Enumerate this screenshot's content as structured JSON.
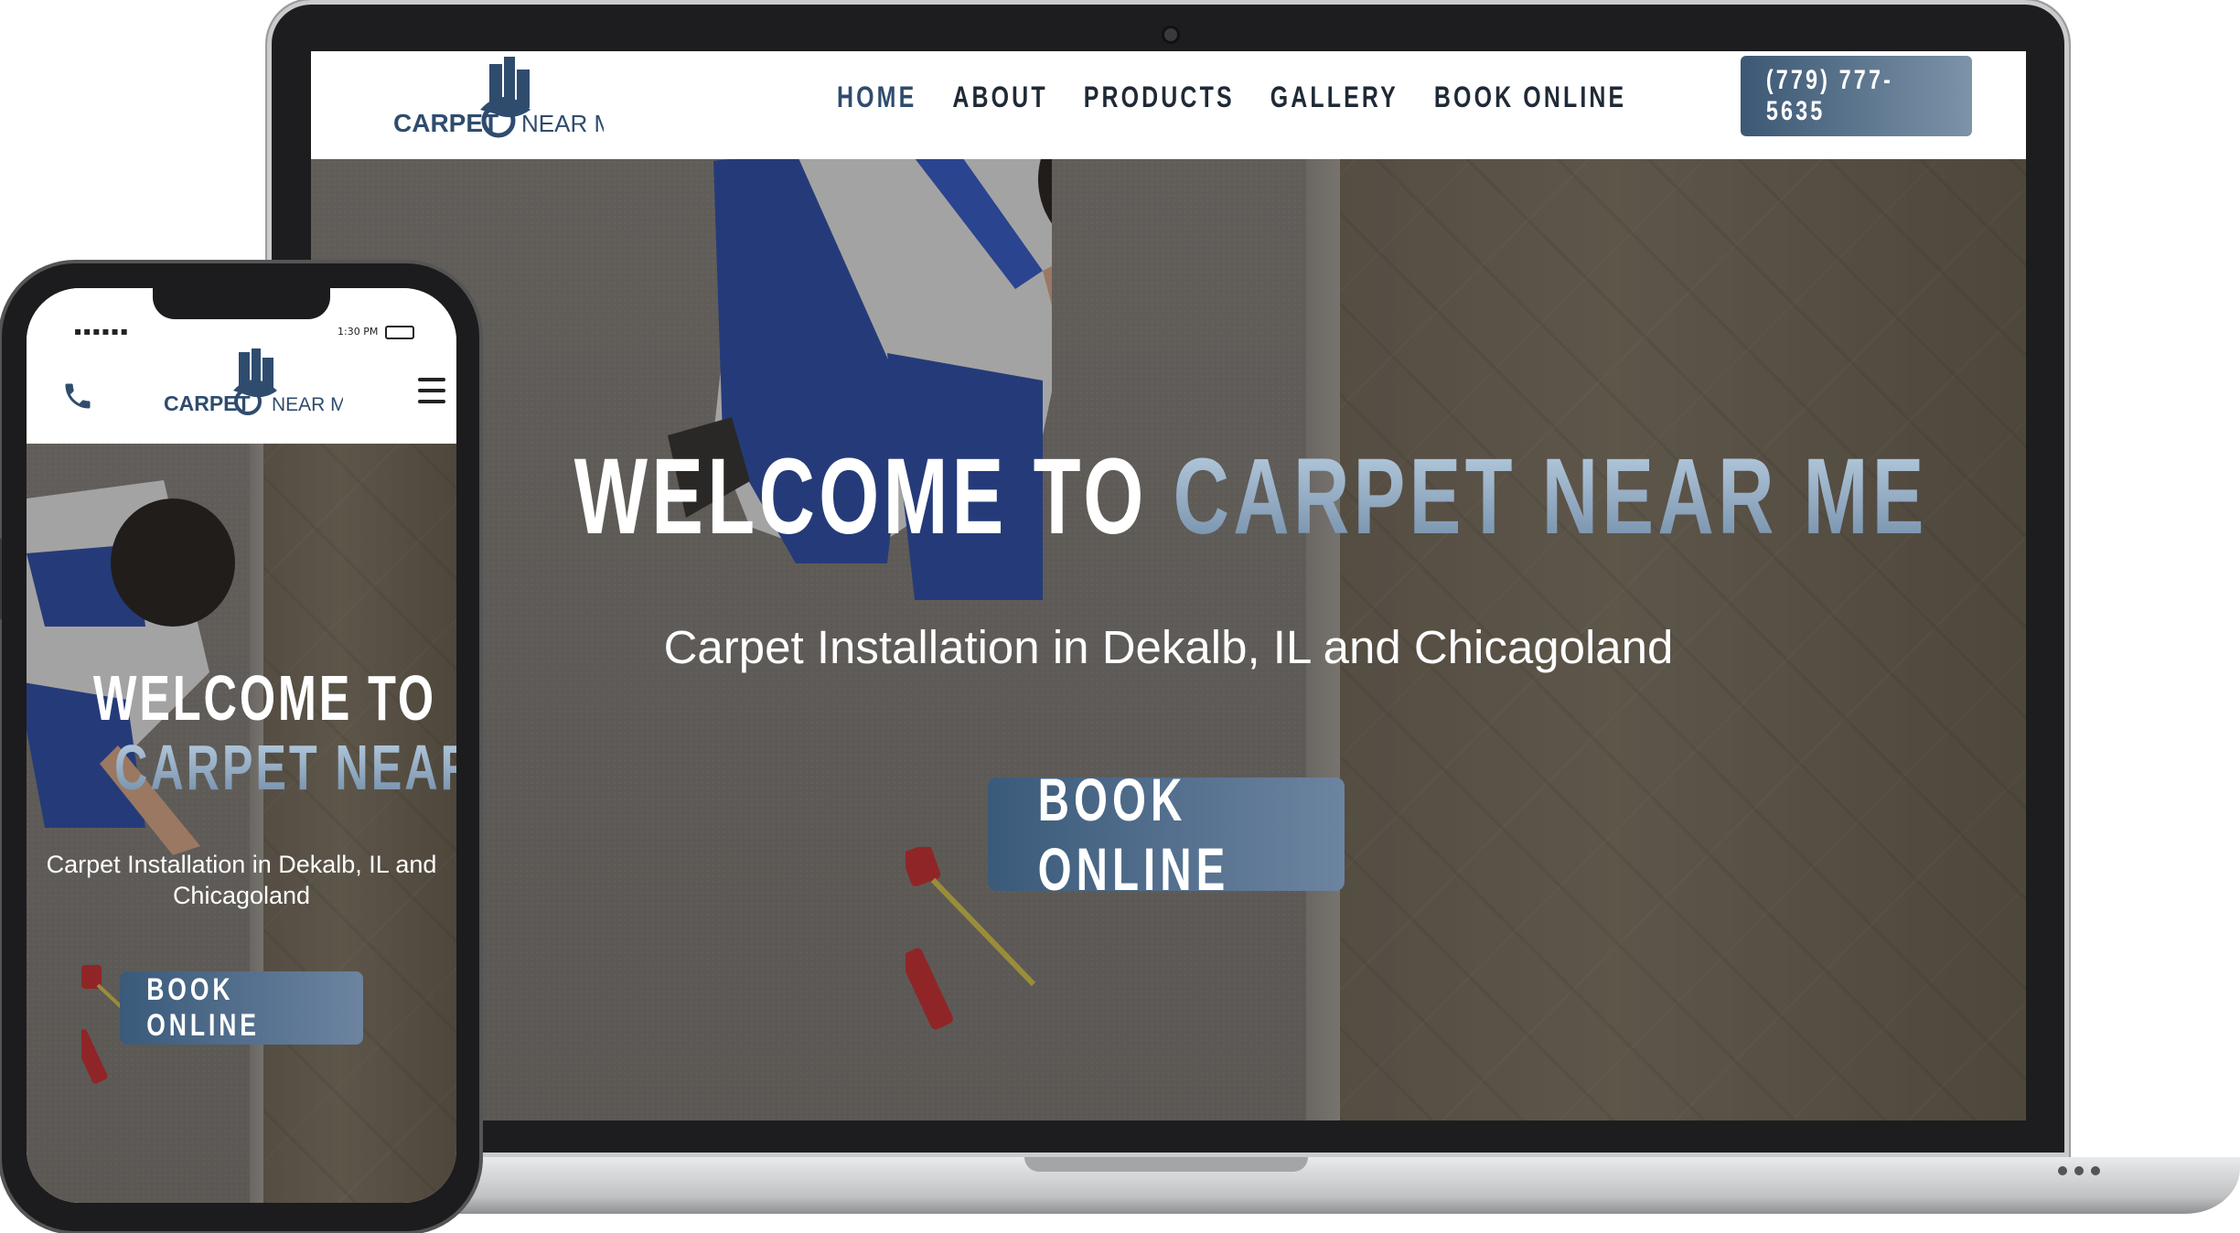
{
  "brand": {
    "logo_text_left": "CARPET",
    "logo_text_right": "NEAR ME",
    "primary_color": "#2f4c6e",
    "accent_gradient": [
      "#bcd0e2",
      "#6f8aa6"
    ]
  },
  "desktop": {
    "nav": {
      "items": [
        {
          "label": "HOME",
          "active": true
        },
        {
          "label": "ABOUT",
          "active": false
        },
        {
          "label": "PRODUCTS",
          "active": false
        },
        {
          "label": "GALLERY",
          "active": false
        },
        {
          "label": "BOOK ONLINE",
          "active": false
        }
      ],
      "phone_label": "(779) 777-5635"
    },
    "hero": {
      "title_white": "WELCOME TO ",
      "title_accent": "CARPET NEAR ME",
      "subtitle": "Carpet Installation in Dekalb, IL and Chicagoland",
      "cta_label": "BOOK ONLINE"
    }
  },
  "mobile": {
    "status": {
      "signal": "▪▪▪▪▪▪",
      "time": "1:30 PM"
    },
    "hero": {
      "title_line1": "WELCOME TO",
      "title_line2": "CARPET NEAR ME",
      "subtitle": "Carpet Installation in Dekalb, IL and Chicagoland",
      "cta_label": "BOOK ONLINE"
    },
    "icons": {
      "call": "phone-icon",
      "menu": "hamburger-menu-icon"
    }
  }
}
